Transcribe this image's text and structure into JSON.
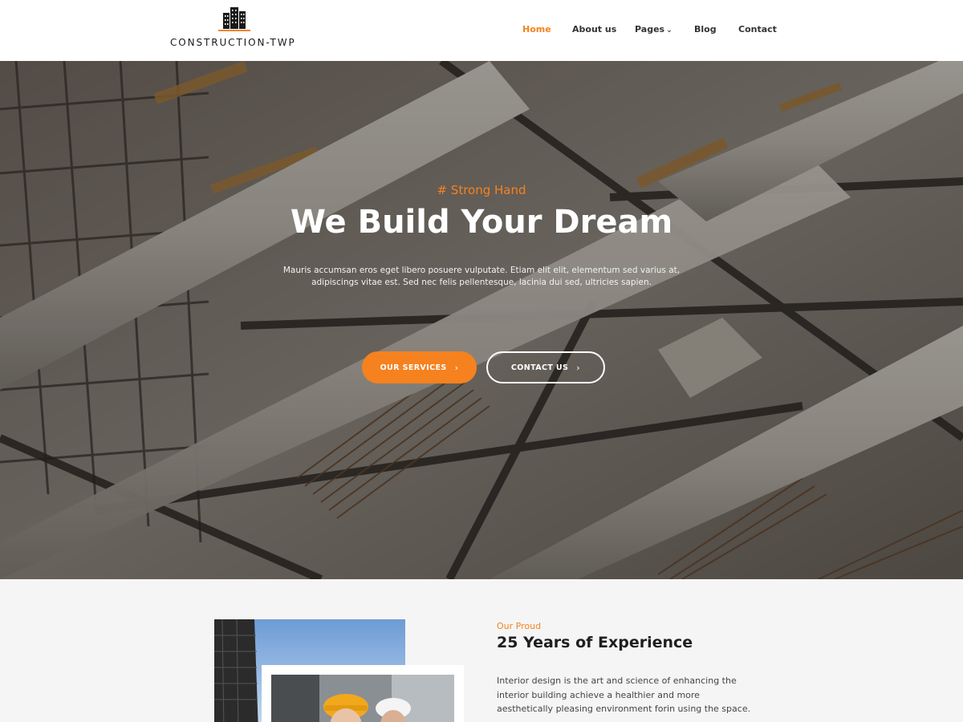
{
  "header": {
    "logo_text": "CONSTRUCTION-TWP",
    "nav": [
      {
        "label": "Home",
        "active": true
      },
      {
        "label": "About us",
        "active": false
      },
      {
        "label": "Pages",
        "active": false,
        "has_dropdown": true
      },
      {
        "label": "Blog",
        "active": false
      },
      {
        "label": "Contact",
        "active": false
      }
    ],
    "dropdown_icon": "chevron-down-icon",
    "logo_icon": "building-icon"
  },
  "hero": {
    "kicker": "# Strong Hand",
    "title": "We Build Your Dream",
    "subtitle": "Mauris accumsan eros eget libero posuere vulputate. Etiam elit elit, elementum sed varius at, adipiscings vitae est. Sed nec felis pellentesque, lacinia dui sed, ultricies sapien.",
    "buttons": [
      {
        "label": "OUR SERVICES",
        "style": "primary",
        "icon": "chevron-right-icon"
      },
      {
        "label": "CONTACT US",
        "style": "outline",
        "icon": "chevron-right-icon"
      }
    ]
  },
  "about": {
    "kicker": "Our Proud",
    "title": "25 Years of Experience",
    "text": "Interior design is the art and science of enhancing the interior building achieve a healthier and more aesthetically pleasing environment forin using the space."
  },
  "colors": {
    "accent": "#f5821f",
    "text_dark": "#1f1f1f",
    "header_bg": "#ffffff",
    "section_bg": "#f5f5f5"
  }
}
